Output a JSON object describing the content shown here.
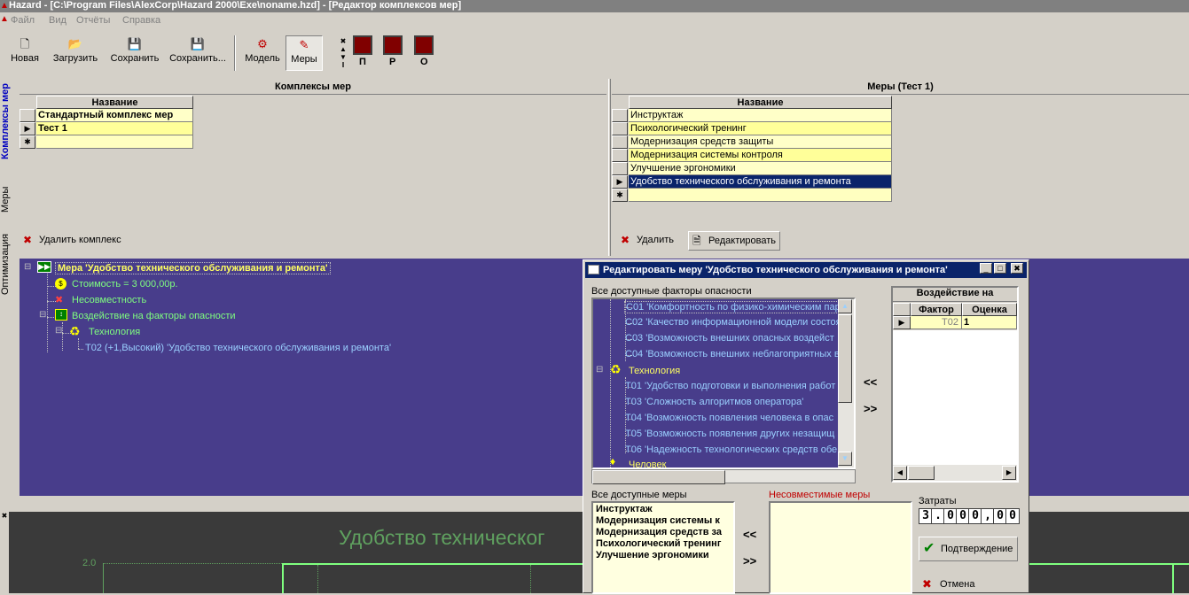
{
  "window": {
    "title": "Hazard - [C:\\Program Files\\AlexCorp\\Hazard 2000\\Exe\\noname.hzd] - [Редактор комплексов мер]"
  },
  "menu": [
    "Файл",
    "Вид",
    "Отчёты",
    "Справка"
  ],
  "toolbar": {
    "buttons": [
      {
        "label": "Новая",
        "icon": "new-document-icon"
      },
      {
        "label": "Загрузить",
        "icon": "open-folder-icon"
      },
      {
        "label": "Сохранить",
        "icon": "floppy-disk-icon"
      },
      {
        "label": "Сохранить...",
        "icon": "floppy-save-as-icon"
      },
      {
        "label": "Модель",
        "icon": "model-icon"
      },
      {
        "label": "Меры",
        "icon": "measures-icon"
      }
    ],
    "indicators": [
      "П",
      "Р",
      "О"
    ]
  },
  "vtabs": [
    "Комплексы мер",
    "Меры",
    "Оптимизация"
  ],
  "complexes": {
    "title": "Комплексы мер",
    "column": "Название",
    "rows": [
      "Стандартный комплекс мер",
      "Тест 1"
    ],
    "delete_label": "Удалить комплекс"
  },
  "measures": {
    "title": "Меры (Тест 1)",
    "column": "Название",
    "rows": [
      "Инструктаж",
      "Психологический тренинг",
      "Модернизация средств защиты",
      "Модернизация системы контроля",
      "Улучшение эргономики",
      "Удобство технического обслуживания и ремонта"
    ],
    "delete_label": "Удалить",
    "edit_label": "Редактировать"
  },
  "tree": {
    "root": "Мера 'Удобство технического обслуживания и ремонта'",
    "cost": "Стоимость = 3 000,00р.",
    "incompat": "Несовместность",
    "impact": "Воздействие на факторы опасности",
    "tech": "Технология",
    "t02": "T02  (+1,Высокий)  'Удобство технического обслуживания и ремонта'"
  },
  "chart": {
    "title": "Удобство техническог",
    "ytick": "2.0"
  },
  "dialog": {
    "title": "Редактировать меру 'Удобство технического обслуживания и ремонта'",
    "factors_label": "Все доступные факторы опасности",
    "factors": [
      "C01  'Комфортность по физико-химическим пар",
      "C02  'Качество информационной модели состоя",
      "C03  'Возможность внешних опасных воздейст",
      "C04  'Возможность внешних неблагоприятных в",
      "Технология",
      "T01  'Удобство подготовки и выполнения работ",
      "T03  'Сложность алгоритмов оператора'",
      "T04  'Возможность появления человека в опас",
      "T05  'Возможность появления других незащищ",
      "T06  'Надежность технологических средств обе",
      "Человек"
    ],
    "impact_title": "Воздействие на",
    "impact_cols": [
      "Фактор",
      "Оценка"
    ],
    "impact_row": {
      "factor": "T02",
      "score": "1"
    },
    "move_left": "<<",
    "move_right": ">>",
    "all_measures_label": "Все доступные меры",
    "all_measures": [
      "Инструктаж",
      "Модернизация системы к",
      "Модернизация средств за",
      "Психологический тренинг",
      "Улучшение эргономики"
    ],
    "incompat_label": "Несовместимые меры",
    "cost_label": "Затраты",
    "cost_digits": [
      "3",
      ".",
      "0",
      "0",
      "0",
      ",",
      "0",
      "0"
    ],
    "confirm_label": "Подтверждение",
    "cancel_label": "Отмена"
  }
}
